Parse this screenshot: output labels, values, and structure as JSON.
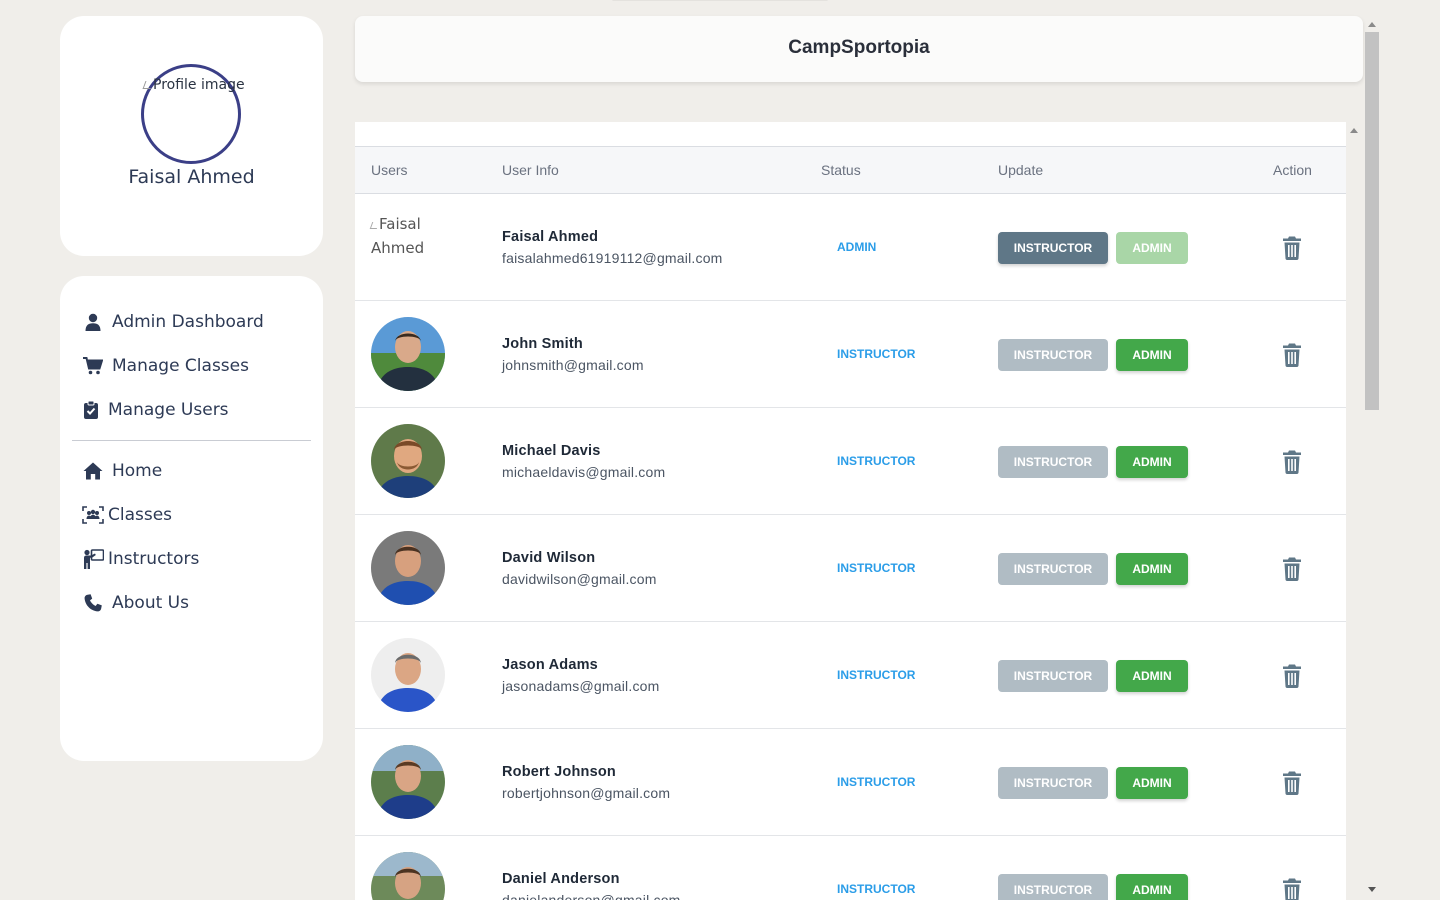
{
  "app_title": "CampSportopia",
  "profile": {
    "image_alt": "Profile image",
    "name": "Faisal Ahmed"
  },
  "nav": {
    "admin_items": [
      {
        "label": "Admin Dashboard",
        "icon": "user-icon"
      },
      {
        "label": "Manage Classes",
        "icon": "cart-icon"
      },
      {
        "label": "Manage Users",
        "icon": "clipboard-check-icon"
      }
    ],
    "main_items": [
      {
        "label": "Home",
        "icon": "home-icon"
      },
      {
        "label": "Classes",
        "icon": "group-scan-icon"
      },
      {
        "label": "Instructors",
        "icon": "instructor-icon"
      },
      {
        "label": "About Us",
        "icon": "phone-icon"
      }
    ]
  },
  "table": {
    "headers": [
      "Users",
      "User Info",
      "Status",
      "Update",
      "Action"
    ],
    "instructor_button": "INSTRUCTOR",
    "admin_button": "ADMIN",
    "rows": [
      {
        "name": "Faisal Ahmed",
        "email": "faisalahmed61919112@gmail.com",
        "status": "ADMIN",
        "photo_alt": "Faisal Ahmed",
        "has_photo": false,
        "instructor_enabled": true,
        "admin_enabled": false
      },
      {
        "name": "John Smith",
        "email": "johnsmith@gmail.com",
        "status": "INSTRUCTOR",
        "has_photo": true,
        "instructor_enabled": false,
        "admin_enabled": true
      },
      {
        "name": "Michael Davis",
        "email": "michaeldavis@gmail.com",
        "status": "INSTRUCTOR",
        "has_photo": true,
        "instructor_enabled": false,
        "admin_enabled": true
      },
      {
        "name": "David Wilson",
        "email": "davidwilson@gmail.com",
        "status": "INSTRUCTOR",
        "has_photo": true,
        "instructor_enabled": false,
        "admin_enabled": true
      },
      {
        "name": "Jason Adams",
        "email": "jasonadams@gmail.com",
        "status": "INSTRUCTOR",
        "has_photo": true,
        "instructor_enabled": false,
        "admin_enabled": true
      },
      {
        "name": "Robert Johnson",
        "email": "robertjohnson@gmail.com",
        "status": "INSTRUCTOR",
        "has_photo": true,
        "instructor_enabled": false,
        "admin_enabled": true
      },
      {
        "name": "Daniel Anderson",
        "email": "danielanderson@gmail.com",
        "status": "INSTRUCTOR",
        "has_photo": true,
        "instructor_enabled": false,
        "admin_enabled": true
      }
    ]
  },
  "colors": {
    "background": "#f0eeea",
    "status_text": "#2b9de8",
    "instructor_active": "#5f7787",
    "instructor_disabled": "#b0bcc4",
    "admin_active": "#43a84a",
    "admin_disabled": "#a9d6a7",
    "nav_text": "#2d3a55",
    "avatar_ring": "#3b3f87"
  }
}
